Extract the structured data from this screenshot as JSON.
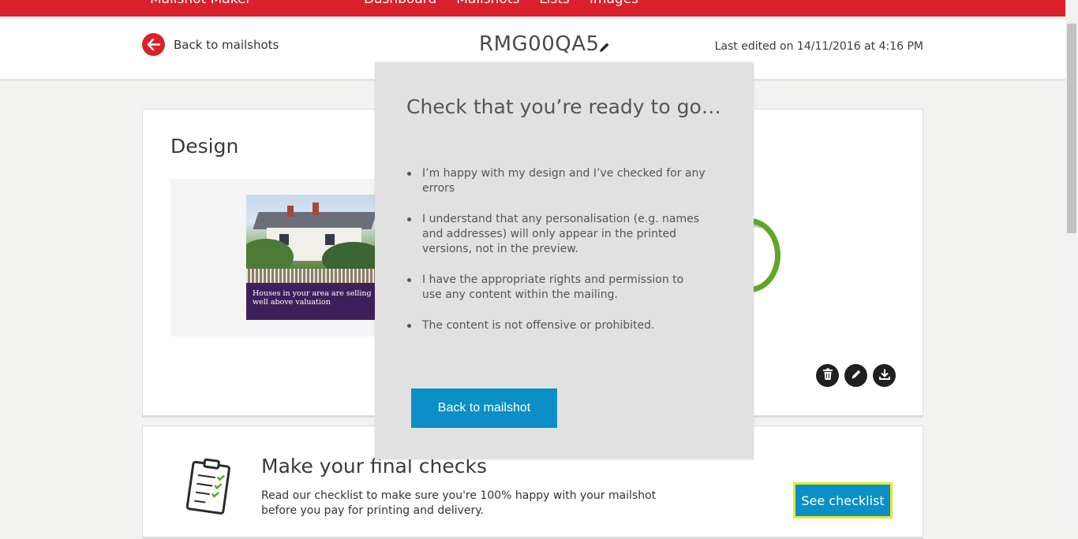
{
  "nav": {
    "brand": "Mailshot Maker",
    "links": [
      "Dashboard",
      "Mailshots",
      "Lists",
      "Images"
    ]
  },
  "header": {
    "back_label": "Back to mailshots",
    "mailshot_name": "RMG00QA5",
    "last_edited": "Last edited on 14/11/2016 at 4:16 PM"
  },
  "design_card": {
    "title": "Design",
    "preview_caption": "Houses in your area are selling well above valuation"
  },
  "checks_card": {
    "title": "Make your final checks",
    "body": "Read our checklist to make sure you're 100% happy with your mailshot before you pay for printing and delivery.",
    "button_label": "See checklist"
  },
  "modal": {
    "title": "Check that you’re ready to go…",
    "items": [
      "I’m happy with my design and I’ve checked for any errors",
      "I understand that any personalisation (e.g. names and addresses) will only appear in the printed versions, not in the preview.",
      "I have the appropriate rights and permission to use any content within the mailing.",
      "The content is not offensive or prohibited."
    ],
    "button_label": "Back to mailshot"
  },
  "colors": {
    "brand_red": "#da202a",
    "action_blue": "#0b8fc6",
    "highlight_yellow": "#e6ea2b",
    "progress_green": "#5fa528"
  }
}
